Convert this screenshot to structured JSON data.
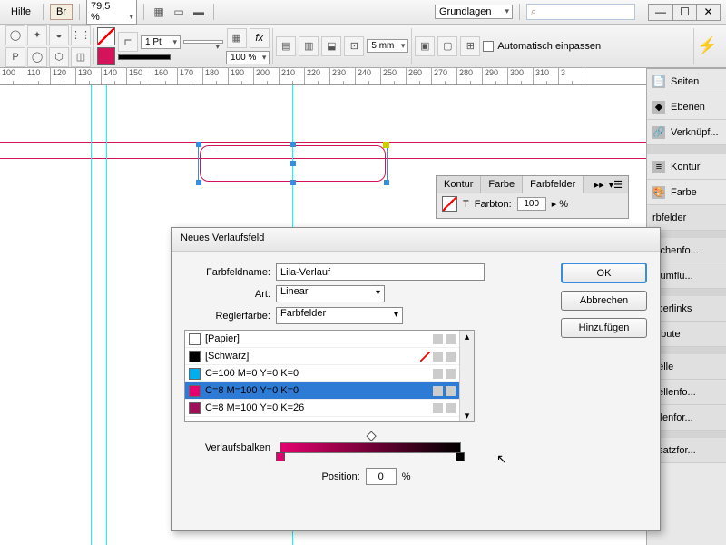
{
  "menubar": {
    "help": "Hilfe",
    "br": "Br",
    "zoom": "79,5 %",
    "workspace": "Grundlagen",
    "search_ph": "⌕"
  },
  "toolbar2": {
    "stroke": "1 Pt",
    "opacity": "100 %",
    "dim": "5 mm",
    "autofit": "Automatisch einpassen"
  },
  "ruler": [
    "100",
    "110",
    "120",
    "130",
    "140",
    "150",
    "160",
    "170",
    "180",
    "190",
    "200",
    "210",
    "220",
    "230",
    "240",
    "250",
    "260",
    "270",
    "280",
    "290",
    "300",
    "310",
    "3"
  ],
  "rpanel": {
    "items": [
      "Seiten",
      "Ebenen",
      "Verknüpf...",
      "Kontur",
      "Farbe",
      "rbfelder",
      "eichenfo...",
      "xtumflu...",
      "yperlinks",
      "tribute",
      "belle",
      "bellenfo...",
      "ellenfor...",
      "bsatzfor..."
    ]
  },
  "mini": {
    "tabs": [
      "Kontur",
      "Farbe",
      "Farbfelder"
    ],
    "tint_lbl": "Farbton:",
    "tint": "100",
    "tint_sfx": "▸ %",
    "ohne": "[Ohne]"
  },
  "dialog": {
    "title": "Neues Verlaufsfeld",
    "name_lbl": "Farbfeldname:",
    "name": "Lila-Verlauf",
    "type_lbl": "Art:",
    "type": "Linear",
    "color_lbl": "Reglerfarbe:",
    "color": "Farbfelder",
    "swatches": [
      "[Papier]",
      "[Schwarz]",
      "C=100 M=0 Y=0 K=0",
      "C=8 M=100 Y=0 K=0",
      "C=8 M=100 Y=0 K=26"
    ],
    "grad_lbl": "Verlaufsbalken",
    "pos_lbl": "Position:",
    "pos": "0",
    "pos_sfx": "%",
    "ok": "OK",
    "cancel": "Abbrechen",
    "add": "Hinzufügen"
  }
}
